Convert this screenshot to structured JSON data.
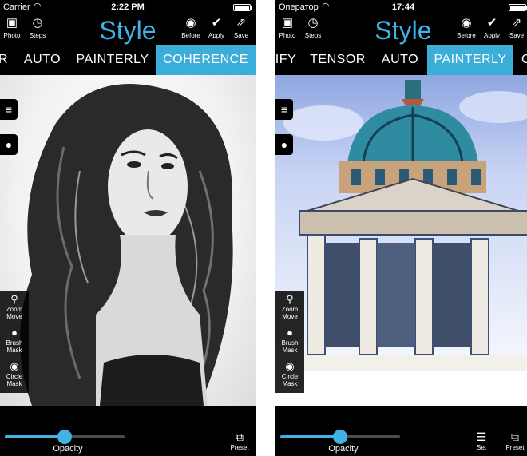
{
  "left": {
    "status": {
      "carrier": "Carrier",
      "time": "2:22 PM"
    },
    "toolbar": {
      "title": "Style",
      "photo_label": "Photo",
      "steps_label": "Steps",
      "before_label": "Before",
      "apply_label": "Apply",
      "save_label": "Save"
    },
    "tabs": [
      "R",
      "AUTO",
      "PAINTERLY",
      "COHERENCE"
    ],
    "active_tab": "COHERENCE",
    "side_tools": {
      "zoom": [
        "Zoom",
        "Move"
      ],
      "brush": [
        "Brush",
        "Mask"
      ],
      "circle": [
        "Circle",
        "Mask"
      ]
    },
    "bottom": {
      "opacity_label": "Opacity",
      "opacity_value": 0.5,
      "preset_label": "Preset"
    }
  },
  "right": {
    "status": {
      "carrier": "Оператор",
      "time": "17:44"
    },
    "toolbar": {
      "title": "Style",
      "photo_label": "Photo",
      "steps_label": "Steps",
      "before_label": "Before",
      "apply_label": "Apply",
      "save_label": "Save"
    },
    "tabs": [
      "IFY",
      "TENSOR",
      "AUTO",
      "PAINTERLY",
      "C"
    ],
    "active_tab": "PAINTERLY",
    "side_tools": {
      "zoom": [
        "Zoom",
        "Move"
      ],
      "brush": [
        "Brush",
        "Mask"
      ],
      "circle": [
        "Circle",
        "Mask"
      ]
    },
    "bottom": {
      "opacity_label": "Opacity",
      "opacity_value": 0.5,
      "set_label": "Set",
      "preset_label": "Preset"
    }
  },
  "colors": {
    "accent": "#3fb2e6",
    "tab_active": "#3aaed8",
    "bar": "#000000"
  },
  "icons": {
    "photo": "photo-icon",
    "steps": "history-clock-icon",
    "before": "eye-icon",
    "apply": "checkmark-icon",
    "save": "share-icon",
    "menu": "hamburger-menu-icon",
    "record": "circle-dot-icon",
    "zoom": "magnifier-icon",
    "brush": "drop-icon",
    "circle": "circle-target-icon",
    "preset": "preset-copy-icon",
    "set": "sliders-icon"
  }
}
